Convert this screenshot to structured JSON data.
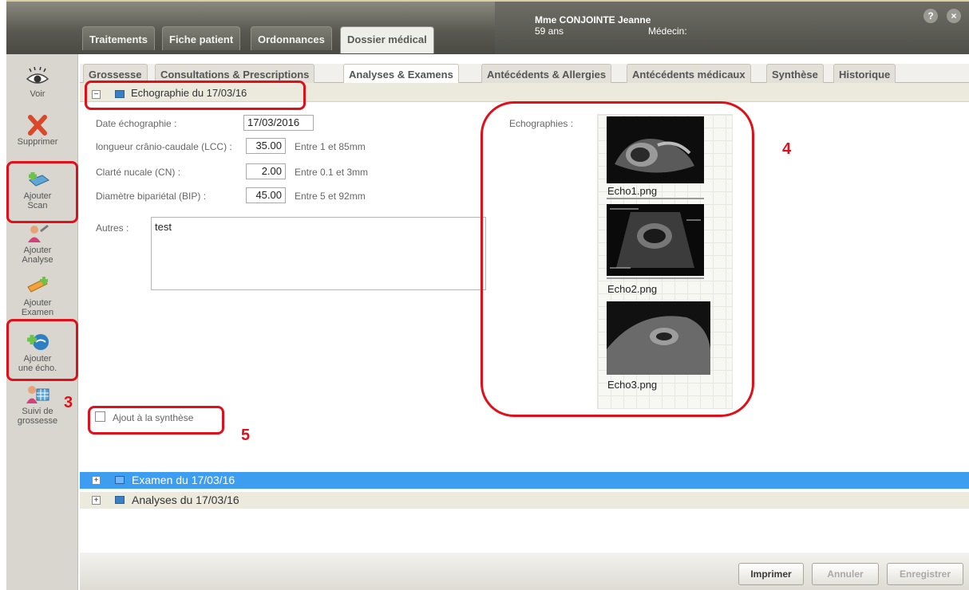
{
  "patient": {
    "name": "Mme CONJOINTE Jeanne",
    "age": "59 ans",
    "doctor_label": "Médecin:"
  },
  "window": {
    "help": "?",
    "close": "×"
  },
  "main_tabs": [
    {
      "label": "Traitements"
    },
    {
      "label": "Fiche patient"
    },
    {
      "label": "Ordonnances"
    },
    {
      "label": "Dossier médical",
      "active": true
    }
  ],
  "sub_tabs": [
    {
      "label": "Grossesse"
    },
    {
      "label": "Consultations & Prescriptions"
    },
    {
      "label": "Analyses & Examens",
      "active": true
    },
    {
      "label": "Antécédents & Allergies"
    },
    {
      "label": "Antécédents médicaux"
    },
    {
      "label": "Synthèse"
    },
    {
      "label": "Historique"
    }
  ],
  "sidebar": [
    {
      "label": "Voir",
      "icon": "eye-icon"
    },
    {
      "label": "Supprimer",
      "icon": "delete-x-icon"
    },
    {
      "label": "Ajouter Scan",
      "icon": "add-scan-icon"
    },
    {
      "label": "Ajouter Analyse",
      "icon": "add-analysis-icon"
    },
    {
      "label": "Ajouter Examen",
      "icon": "add-exam-icon"
    },
    {
      "label": "Ajouter une écho.",
      "icon": "add-echo-icon"
    },
    {
      "label": "Suivi de grossesse",
      "icon": "pregnancy-tracking-icon"
    }
  ],
  "section": {
    "toggle": "−",
    "title": "Echographie du 17/03/16"
  },
  "form": {
    "date_label": "Date échographie :",
    "date_value": "17/03/2016",
    "lcc_label": "longueur crânio-caudale (LCC) :",
    "lcc_value": "35.00",
    "lcc_hint": "Entre 1 et 85mm",
    "cn_label": "Clarté nucale (CN) :",
    "cn_value": "2.00",
    "cn_hint": "Entre 0.1 et 3mm",
    "bip_label": "Diamètre bipariétal (BIP) :",
    "bip_value": "45.00",
    "bip_hint": "Entre 5 et 92mm",
    "autres_label": "Autres :",
    "autres_value": "test",
    "echographies_label": "Echographies :",
    "synthese_label": "Ajout à la synthèse"
  },
  "echos": [
    {
      "name": "Echo1.png"
    },
    {
      "name": "Echo2.png"
    },
    {
      "name": "Echo3.png"
    }
  ],
  "rows": [
    {
      "toggle": "+",
      "label": "Examen du 17/03/16"
    },
    {
      "toggle": "+",
      "label": "Analyses du 17/03/16"
    }
  ],
  "annotations": {
    "a3": "3",
    "a4": "4",
    "a5": "5"
  },
  "footer": {
    "print": "Imprimer",
    "cancel": "Annuler",
    "save": "Enregistrer"
  },
  "colors": {
    "highlight": "#e0101a",
    "selected_row": "#3d9ef1"
  }
}
